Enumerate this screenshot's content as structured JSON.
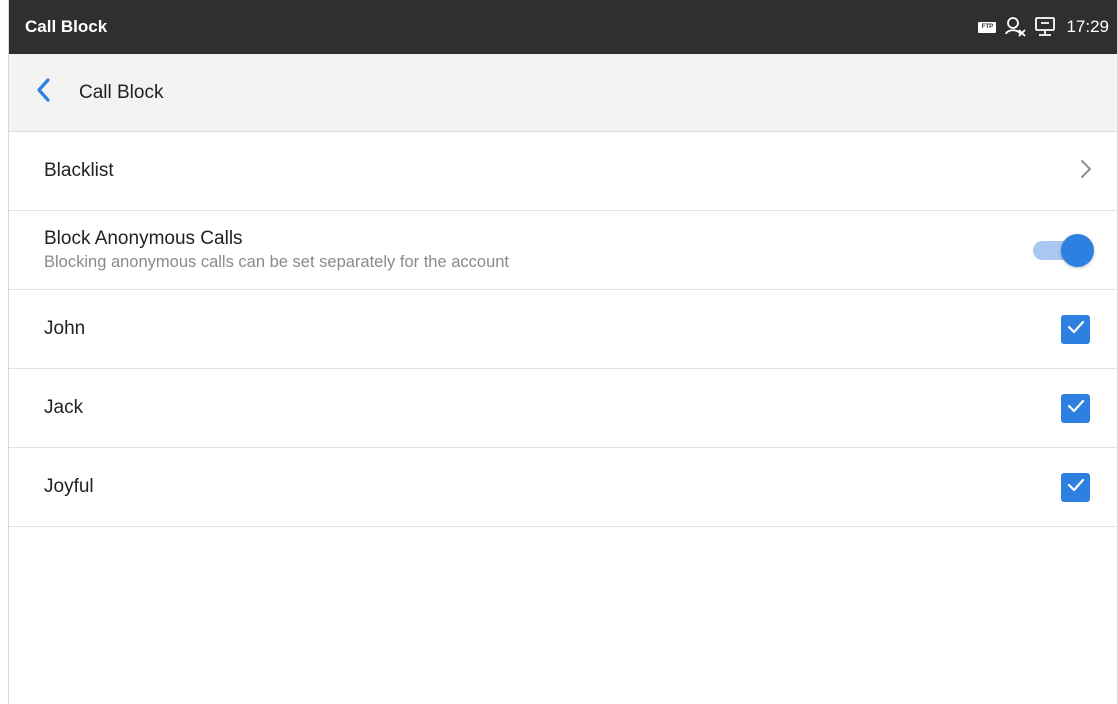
{
  "status_bar": {
    "title": "Call Block",
    "time": "17:29",
    "icons": [
      "ftp-icon",
      "account-offline-icon",
      "network-icon"
    ],
    "ftp_label": "FTP"
  },
  "app_bar": {
    "back_icon": "chevron-left-icon",
    "title": "Call Block"
  },
  "items": [
    {
      "label": "Blacklist",
      "control": "chevron-right-icon"
    },
    {
      "label": "Block Anonymous Calls",
      "sublabel": "Blocking anonymous calls can be set separately for the account",
      "control": "toggle",
      "toggle_on": true
    },
    {
      "label": "John",
      "control": "checkbox",
      "checked": true
    },
    {
      "label": "Jack",
      "control": "checkbox",
      "checked": true
    },
    {
      "label": "Joyful",
      "control": "checkbox",
      "checked": true
    }
  ],
  "colors": {
    "status_bar_bg": "#2f2f2f",
    "app_bar_bg": "#f2f3f2",
    "accent": "#2d7fe0",
    "toggle_track": "#a9c7f0"
  }
}
